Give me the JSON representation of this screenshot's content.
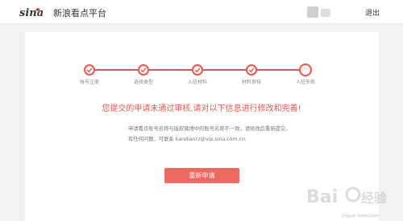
{
  "header": {
    "platform_name": "新浪看点平台",
    "logout_label": "退出"
  },
  "steps": [
    {
      "label": "账号注册",
      "status": "done"
    },
    {
      "label": "选择类型",
      "status": "done"
    },
    {
      "label": "入驻材料",
      "status": "done"
    },
    {
      "label": "材料审核",
      "status": "done"
    },
    {
      "label": "入驻失败",
      "status": "failed"
    }
  ],
  "result": {
    "title": "您提交的申请未通过审核,请对以下信息进行修改和完善!",
    "detail_line_1": "申请看点账号名称与授权微博中的账号名称不一致，请修改后重新提交。",
    "detail_line_2": "有任何问题，可联系 kandianrz@vip.sina.com.cn."
  },
  "actions": {
    "reapply_label": "重新申请"
  },
  "colors": {
    "accent": "#e8574e",
    "button": "#ef6a5e"
  },
  "watermark": {
    "url_text": "jingyan.baidu.com"
  }
}
